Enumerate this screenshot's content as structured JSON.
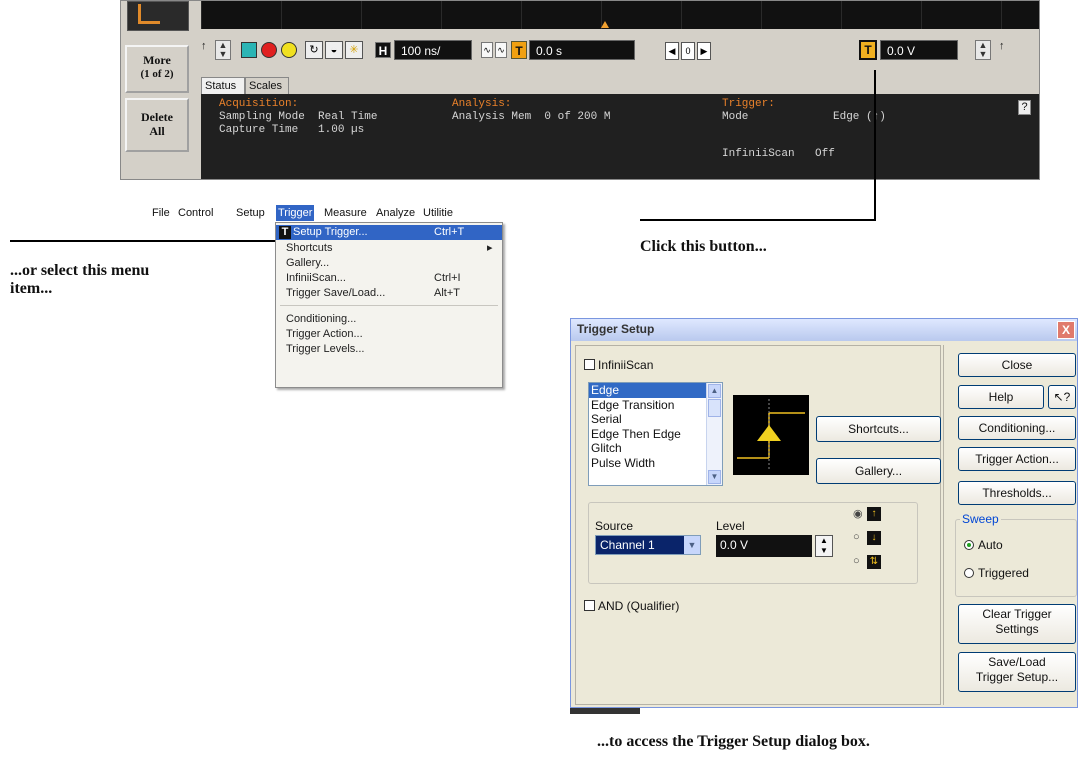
{
  "scope": {
    "more_label": "More",
    "more_sub": "(1 of 2)",
    "delete_label": "Delete",
    "delete_sub": "All",
    "timebase": "100 ns/",
    "delay": "0.0 s",
    "trigger_level": "0.0 V",
    "tabs": [
      "Status",
      "Scales"
    ],
    "status": {
      "acq_header": "Acquisition:",
      "acq_line1": "Sampling Mode  Real Time",
      "acq_line2": "Capture Time   1.00 µs",
      "ana_header": "Analysis:",
      "ana_line1": "Analysis Mem  0 of 200 M",
      "trig_header": "Trigger:",
      "trig_mode_label": "Mode",
      "trig_mode_value": "Edge (↑)",
      "trig_iscan_label": "InfiniiScan",
      "trig_iscan_value": "Off",
      "help": "?"
    }
  },
  "callouts": {
    "button": "Click this button...",
    "menu_line1": "...or select this menu",
    "menu_line2": "item...",
    "dialog": "...to access the Trigger Setup dialog box."
  },
  "menubar": [
    "File",
    "Control",
    "Setup",
    "Trigger",
    "Measure",
    "Analyze",
    "Utilitie"
  ],
  "menu": {
    "items": [
      {
        "label": "Setup Trigger...",
        "shortcut": "Ctrl+T"
      },
      {
        "label": "Shortcuts",
        "shortcut": ""
      },
      {
        "label": "Gallery...",
        "shortcut": ""
      },
      {
        "label": "InfiniiScan...",
        "shortcut": "Ctrl+I"
      },
      {
        "label": "Trigger Save/Load...",
        "shortcut": "Alt+T"
      },
      {
        "label": "Conditioning...",
        "shortcut": ""
      },
      {
        "label": "Trigger Action...",
        "shortcut": ""
      },
      {
        "label": "Trigger Levels...",
        "shortcut": ""
      }
    ]
  },
  "dialog": {
    "title": "Trigger Setup",
    "close_x": "X",
    "infiniiscan": "InfiniiScan",
    "trigger_types": [
      "Edge",
      "Edge Transition",
      "Serial",
      "Edge Then Edge",
      "Glitch",
      "Pulse Width"
    ],
    "shortcuts_btn": "Shortcuts...",
    "gallery_btn": "Gallery...",
    "source_label": "Source",
    "source_value": "Channel 1",
    "level_label": "Level",
    "level_value": "0.0 V",
    "and_qualifier": "AND (Qualifier)",
    "close_btn": "Close",
    "help_btn": "Help",
    "conditioning_btn": "Conditioning...",
    "trigger_action_btn": "Trigger Action...",
    "thresholds_btn": "Thresholds...",
    "sweep_label": "Sweep",
    "sweep_auto": "Auto",
    "sweep_triggered": "Triggered",
    "clear_btn_line1": "Clear Trigger",
    "clear_btn_line2": "Settings",
    "saveload_btn_line1": "Save/Load",
    "saveload_btn_line2": "Trigger Setup..."
  }
}
